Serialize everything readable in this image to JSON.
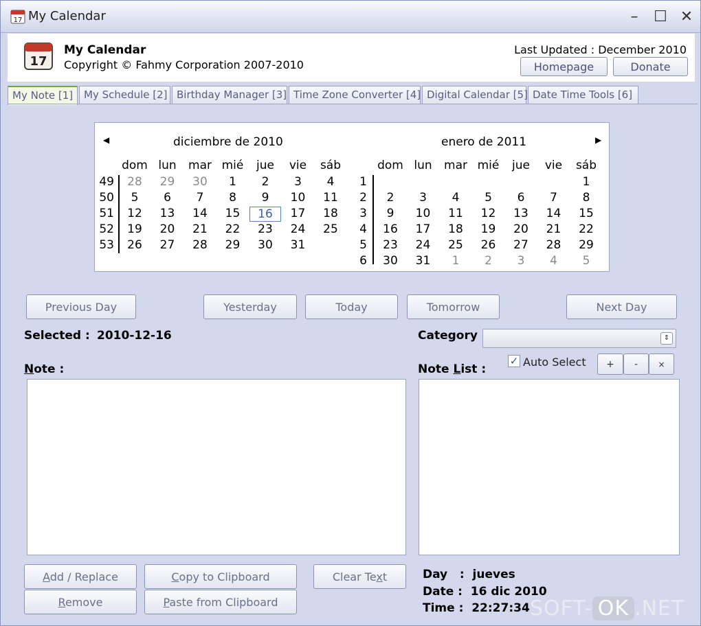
{
  "window": {
    "title": "My Calendar"
  },
  "header": {
    "app_name": "My Calendar",
    "copyright": "Copyright © Fahmy Corporation 2007-2010",
    "last_updated": "Last Updated : December 2010",
    "homepage_label": "Homepage",
    "donate_label": "Donate"
  },
  "tabs": [
    {
      "label": "My Note [1]"
    },
    {
      "label": "My Schedule [2]"
    },
    {
      "label": "Birthday Manager [3]"
    },
    {
      "label": "Time Zone Converter [4]"
    },
    {
      "label": "Digital Calendar [5]"
    },
    {
      "label": "Date Time Tools [6]"
    }
  ],
  "calendar": {
    "left": {
      "title": "diciembre de 2010",
      "dow": [
        "dom",
        "lun",
        "mar",
        "mié",
        "jue",
        "vie",
        "sáb"
      ],
      "weeks": [
        "49",
        "50",
        "51",
        "52",
        "53"
      ],
      "rows": [
        [
          "28",
          "29",
          "30",
          "1",
          "2",
          "3",
          "4"
        ],
        [
          "5",
          "6",
          "7",
          "8",
          "9",
          "10",
          "11"
        ],
        [
          "12",
          "13",
          "14",
          "15",
          "16",
          "17",
          "18"
        ],
        [
          "19",
          "20",
          "21",
          "22",
          "23",
          "24",
          "25"
        ],
        [
          "26",
          "27",
          "28",
          "29",
          "30",
          "31",
          ""
        ]
      ],
      "grey": [
        [
          0,
          0
        ],
        [
          0,
          1
        ],
        [
          0,
          2
        ]
      ],
      "today": [
        2,
        4
      ]
    },
    "right": {
      "title": "enero de 2011",
      "dow": [
        "dom",
        "lun",
        "mar",
        "mié",
        "jue",
        "vie",
        "sáb"
      ],
      "weeks": [
        "1",
        "2",
        "3",
        "4",
        "5",
        "6"
      ],
      "rows": [
        [
          "",
          "",
          "",
          "",
          "",
          "",
          "1"
        ],
        [
          "2",
          "3",
          "4",
          "5",
          "6",
          "7",
          "8"
        ],
        [
          "9",
          "10",
          "11",
          "12",
          "13",
          "14",
          "15"
        ],
        [
          "16",
          "17",
          "18",
          "19",
          "20",
          "21",
          "22"
        ],
        [
          "23",
          "24",
          "25",
          "26",
          "27",
          "28",
          "29"
        ],
        [
          "30",
          "31",
          "1",
          "2",
          "3",
          "4",
          "5"
        ]
      ],
      "grey": [
        [
          5,
          2
        ],
        [
          5,
          3
        ],
        [
          5,
          4
        ],
        [
          5,
          5
        ],
        [
          5,
          6
        ]
      ]
    }
  },
  "nav": {
    "previous_day": "Previous Day",
    "yesterday": "Yesterday",
    "today": "Today",
    "tomorrow": "Tomorrow",
    "next_day": "Next Day"
  },
  "selected": {
    "label": "Selected :",
    "value": "2010-12-16"
  },
  "category": {
    "label": "Category :",
    "value": ""
  },
  "note": {
    "label_prefix": "N",
    "label_rest": "ote :"
  },
  "note_list": {
    "label_a": "Note ",
    "label_u": "L",
    "label_b": "ist :",
    "auto_select": "Auto Select",
    "checked_mark": "✓",
    "add": "+",
    "remove": "-",
    "clear": "×"
  },
  "actions": {
    "add_replace_u": "A",
    "add_replace_rest": "dd / Replace",
    "copy_u": "C",
    "copy_rest": "opy to Clipboard",
    "clear_a": "Clear Te",
    "clear_u": "x",
    "clear_b": "t",
    "remove_u": "R",
    "remove_rest": "emove",
    "paste_u": "P",
    "paste_rest": "aste from Clipboard"
  },
  "info": {
    "day": "Day   :  jueves",
    "date": "Date :  16 dic 2010",
    "time": "Time :  22:27:34"
  },
  "watermark": {
    "a": "SOFT-",
    "b": "OK",
    "c": ".NET"
  }
}
